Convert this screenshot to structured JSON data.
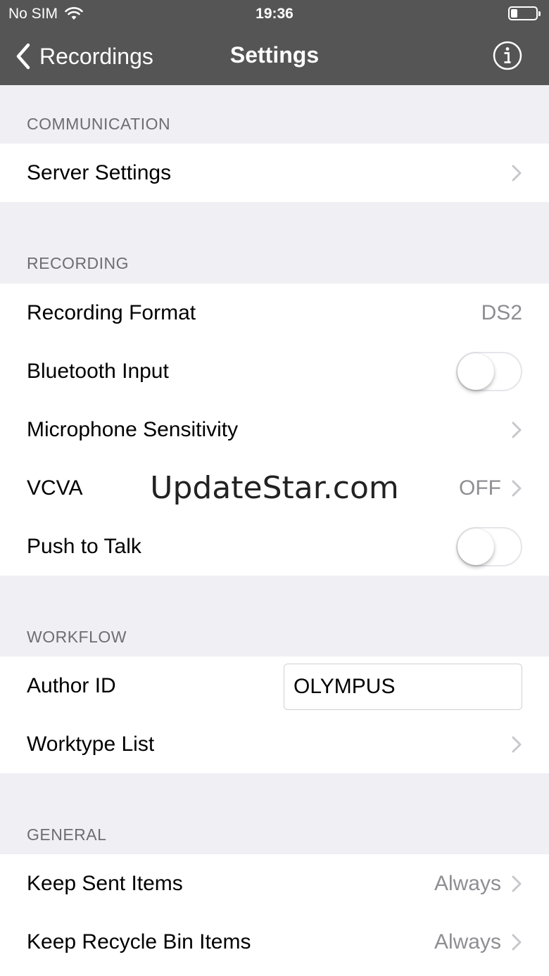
{
  "status_bar": {
    "carrier": "No SIM",
    "time": "19:36",
    "wifi_icon": "wifi-icon",
    "battery_icon": "battery-icon"
  },
  "nav": {
    "back_label": "Recordings",
    "title": "Settings",
    "info_icon": "info-icon"
  },
  "sections": {
    "communication": {
      "header": "COMMUNICATION",
      "server_settings": "Server Settings"
    },
    "recording": {
      "header": "RECORDING",
      "recording_format_label": "Recording Format",
      "recording_format_value": "DS2",
      "bluetooth_input_label": "Bluetooth Input",
      "bluetooth_input_on": false,
      "mic_sensitivity_label": "Microphone Sensitivity",
      "vcva_label": "VCVA",
      "vcva_value": "OFF",
      "push_to_talk_label": "Push to Talk",
      "push_to_talk_on": false
    },
    "workflow": {
      "header": "WORKFLOW",
      "author_id_label": "Author ID",
      "author_id_value": "OLYMPUS",
      "worktype_list_label": "Worktype List"
    },
    "general": {
      "header": "GENERAL",
      "keep_sent_label": "Keep Sent Items",
      "keep_sent_value": "Always",
      "keep_recycle_label": "Keep Recycle Bin Items",
      "keep_recycle_value": "Always"
    }
  },
  "watermark": "UpdateStar.com",
  "colors": {
    "bar": "#555555",
    "background": "#efeff4",
    "secondary_text": "#8e8e93",
    "header_text": "#6d6d72"
  }
}
